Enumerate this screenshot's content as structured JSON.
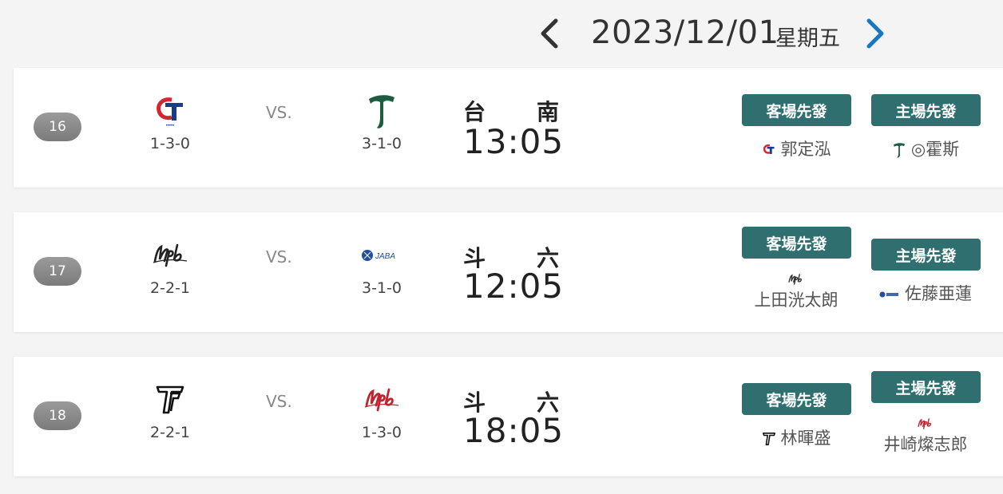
{
  "header": {
    "date": "2023/12/01",
    "weekday": "星期五",
    "prev_icon": "chevron-left-icon",
    "next_icon": "chevron-right-icon",
    "next_color": "#1a78c2"
  },
  "labels": {
    "vs": "VS.",
    "away_starter": "客場先發",
    "home_starter": "主場先發"
  },
  "games": [
    {
      "number": "16",
      "away": {
        "logo": "ct-logo",
        "record": "1-3-0"
      },
      "home": {
        "logo": "t-logo",
        "record": "3-1-0"
      },
      "venue": [
        "台",
        "南"
      ],
      "time": "13:05",
      "away_pitcher": {
        "name": "郭定泓",
        "logo": "ct-logo"
      },
      "home_pitcher": {
        "name": "◎霍斯",
        "logo": "t-logo"
      }
    },
    {
      "number": "17",
      "away": {
        "logo": "npb-logo",
        "record": "2-2-1"
      },
      "home": {
        "logo": "jaba-logo",
        "record": "3-1-0",
        "logo_text": "JABA"
      },
      "venue": [
        "斗",
        "六"
      ],
      "time": "12:05",
      "away_pitcher": {
        "name": "上田洸太朗",
        "logo": "npb-logo"
      },
      "home_pitcher": {
        "name": "佐藤亜蓮",
        "logo": "jaba-logo"
      }
    },
    {
      "number": "18",
      "away": {
        "logo": "tt-logo",
        "record": "2-2-1"
      },
      "home": {
        "logo": "npb-red-logo",
        "record": "1-3-0"
      },
      "venue": [
        "斗",
        "六"
      ],
      "time": "18:05",
      "away_pitcher": {
        "name": "林暉盛",
        "logo": "tt-logo"
      },
      "home_pitcher": {
        "name": "井崎燦志郎",
        "logo": "npb-red-logo"
      }
    }
  ],
  "colors": {
    "button": "#2f6f6f",
    "t_green": "#1d5c40",
    "ct_red": "#d22630",
    "ct_blue": "#1b3a8c",
    "jaba_blue": "#1f4fa0",
    "npb_red": "#c0242e"
  }
}
